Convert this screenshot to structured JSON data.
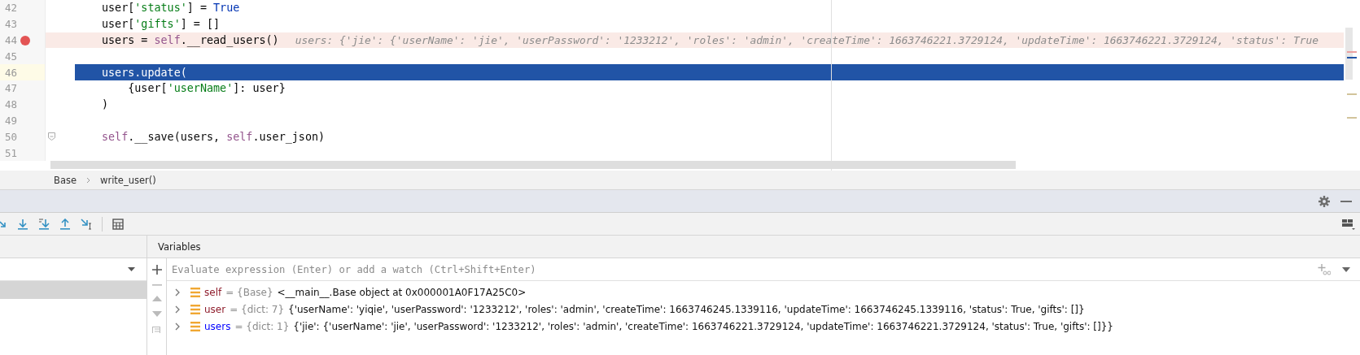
{
  "editor": {
    "lines": [
      {
        "number": "42",
        "breakpoint": false,
        "current": false,
        "fold": false,
        "tokens": [
          {
            "kind": "plain",
            "text": "user["
          },
          {
            "kind": "string",
            "text": "'status'"
          },
          {
            "kind": "plain",
            "text": "] = "
          },
          {
            "kind": "keyword",
            "text": "True"
          }
        ]
      },
      {
        "number": "43",
        "breakpoint": false,
        "current": false,
        "fold": false,
        "tokens": [
          {
            "kind": "plain",
            "text": "user["
          },
          {
            "kind": "string",
            "text": "'gifts'"
          },
          {
            "kind": "plain",
            "text": "] = []"
          }
        ]
      },
      {
        "number": "44",
        "breakpoint": true,
        "current": false,
        "fold": false,
        "tokens": [
          {
            "kind": "plain",
            "text": "users = "
          },
          {
            "kind": "self",
            "text": "self"
          },
          {
            "kind": "plain",
            "text": ".__read_users()"
          }
        ],
        "hint": "users: {'jie': {'userName': 'jie', 'userPassword': '1233212', 'roles': 'admin', 'createTime': 1663746221.3729124, 'updateTime': 1663746221.3729124, 'status': True"
      },
      {
        "number": "45",
        "breakpoint": false,
        "current": false,
        "fold": false
      },
      {
        "number": "46",
        "breakpoint": false,
        "current": true,
        "fold": false,
        "tokens": [
          {
            "kind": "plain",
            "text": "users.update("
          }
        ]
      },
      {
        "number": "47",
        "breakpoint": false,
        "current": false,
        "fold": false,
        "tokens": [
          {
            "kind": "plain",
            "text": "    {user["
          },
          {
            "kind": "string",
            "text": "'userName'"
          },
          {
            "kind": "plain",
            "text": "]: user}"
          }
        ]
      },
      {
        "number": "48",
        "breakpoint": false,
        "current": false,
        "fold": false,
        "tokens": [
          {
            "kind": "plain",
            "text": ")"
          }
        ]
      },
      {
        "number": "49",
        "breakpoint": false,
        "current": false,
        "fold": false
      },
      {
        "number": "50",
        "breakpoint": false,
        "current": false,
        "fold": true,
        "tokens": [
          {
            "kind": "self",
            "text": "self"
          },
          {
            "kind": "plain",
            "text": ".__save(users, "
          },
          {
            "kind": "self",
            "text": "self"
          },
          {
            "kind": "plain",
            "text": ".user_json)"
          }
        ]
      },
      {
        "number": "51",
        "breakpoint": false,
        "current": false,
        "fold": false
      }
    ]
  },
  "breadcrumbs": [
    "Base",
    "write_user()"
  ],
  "debugger": {
    "frames": {
      "rows": [
        {
          "selected": true
        }
      ]
    },
    "variables": {
      "title": "Variables",
      "placeholder": "Evaluate expression (Enter) or add a watch (Ctrl+Shift+Enter)",
      "items": [
        {
          "name": "self",
          "color": "#8f1d2c",
          "type": "= {Base}",
          "value": "<__main__.Base object at 0x000001A0F17A25C0>"
        },
        {
          "name": "user",
          "color": "#8f1d2c",
          "type": "= {dict: 7}",
          "value": "{'userName': 'yiqie', 'userPassword': '1233212', 'roles': 'admin', 'createTime': 1663746245.1339116, 'updateTime': 1663746245.1339116, 'status': True, 'gifts': []}"
        },
        {
          "name": "users",
          "color": "#0000ff",
          "type": "= {dict: 1}",
          "value": "{'jie': {'userName': 'jie', 'userPassword': '1233212', 'roles': 'admin', 'createTime': 1663746221.3729124, 'updateTime': 1663746221.3729124, 'status': True, 'gifts': []}}"
        }
      ]
    }
  }
}
